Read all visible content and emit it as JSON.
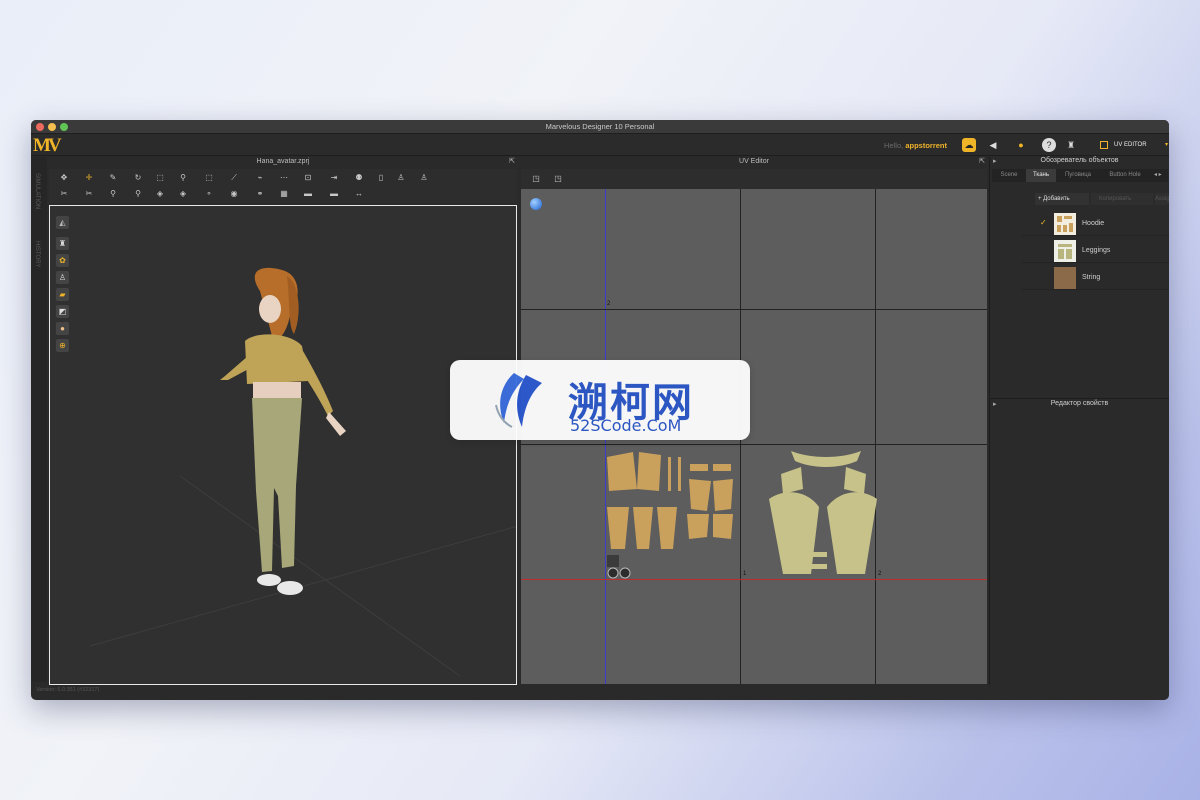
{
  "window": {
    "title": "Marvelous Designer 10 Personal"
  },
  "menubar": {
    "user_prefix": "Hello,",
    "user_name": "appstorrent",
    "uv_editor_label": "UV EDITOR"
  },
  "left_panel": {
    "file_title": "Hana_avatar.zprj",
    "side_tab_1": "SIMULATION",
    "side_tab_2": "HISTORY",
    "version": "Version: 6.0.351 (#32317)"
  },
  "uv_panel": {
    "title": "UV Editor",
    "labels": {
      "a": "2",
      "b": "1",
      "c": "2"
    }
  },
  "object_browser": {
    "title": "Обозреватель объектов",
    "tabs": [
      "Scene",
      "Ткань",
      "Пуговица",
      "Button Hole"
    ],
    "add_label": "+ Добавить",
    "copy_label": "Копировать",
    "assign_label": "Assign",
    "items": [
      {
        "name": "Hoodie",
        "checked": true
      },
      {
        "name": "Leggings",
        "checked": false
      },
      {
        "name": "String",
        "checked": false
      }
    ]
  },
  "property_editor": {
    "title": "Редактор свойств"
  },
  "watermark": {
    "text_cn": "溯柯网",
    "text_en": "52SCode.CoM"
  },
  "colors": {
    "accent": "#f0b429",
    "background": "#2a2a2b",
    "uv_bg": "#5d5d5d",
    "pattern": "#c9a15c"
  }
}
